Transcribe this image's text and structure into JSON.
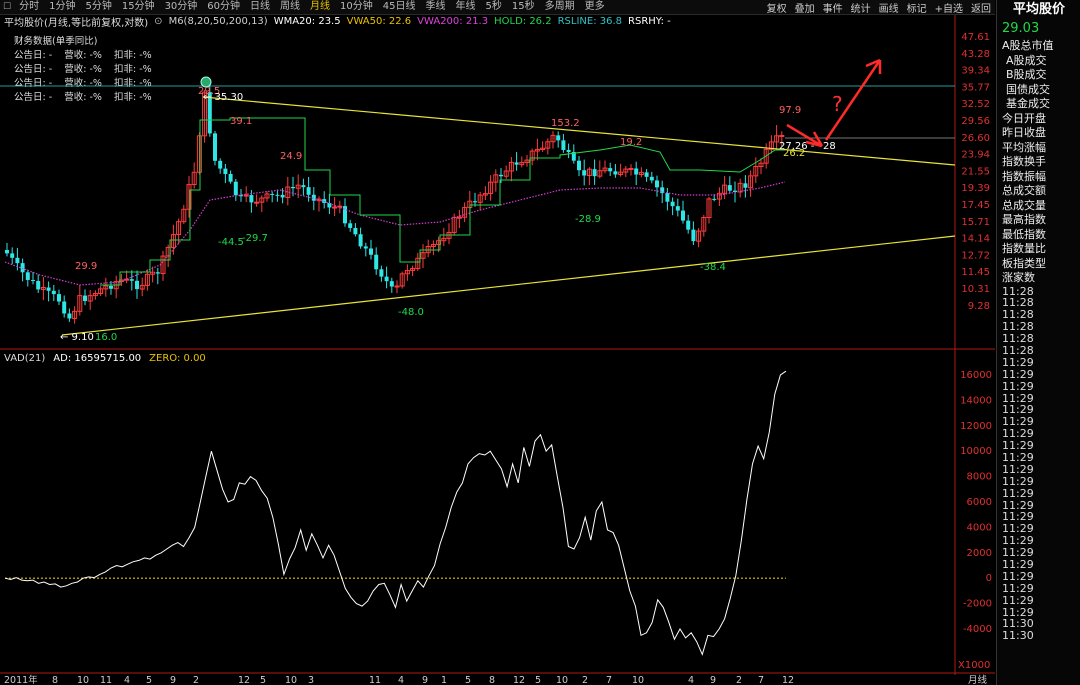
{
  "toolbar": {
    "periods": [
      "分时",
      "1分钟",
      "5分钟",
      "15分钟",
      "30分钟",
      "60分钟",
      "日线",
      "周线",
      "月线",
      "10分钟",
      "45日线",
      "季线",
      "年线",
      "5秒",
      "15秒",
      "多周期",
      "更多"
    ],
    "active_index": 8,
    "right": [
      "复权",
      "叠加",
      "事件",
      "统计",
      "画线",
      "标记",
      "+自选",
      "返回"
    ]
  },
  "main_indicator": {
    "name": "平均股价(月线,等比前复权,对数)",
    "items": [
      {
        "text": "M6(8,20,50,200,13)",
        "color": "#d0d0d0"
      },
      {
        "text": "WMA20: 23.5",
        "color": "#ffffff"
      },
      {
        "text": "VWA50: 22.6",
        "color": "#e8c100"
      },
      {
        "text": "VWA200: 21.3",
        "color": "#e040e0"
      },
      {
        "text": "HOLD: 26.2",
        "color": "#1fd94a"
      },
      {
        "text": "RSLINE: 36.8",
        "color": "#2ec4c4"
      },
      {
        "text": "RSRHY: -",
        "color": "#ffffff"
      }
    ]
  },
  "finance": {
    "title": "财务数据(单季同比)",
    "rows": [
      "公告日: -    营收: -%    扣非: -%",
      "公告日: -    营收: -%    扣非: -%",
      "公告日: -    营收: -%    扣非: -%",
      "公告日: -    营收: -%    扣非: -%"
    ]
  },
  "price_axis": [
    "47.61",
    "43.28",
    "39.34",
    "35.77",
    "32.52",
    "29.56",
    "26.60",
    "23.94",
    "21.55",
    "19.39",
    "17.45",
    "15.71",
    "14.14",
    "12.72",
    "11.45",
    "10.31",
    "9.28"
  ],
  "chart_labels": {
    "high_peak": "35.30",
    "peak_top": "29.5",
    "low": "9.10",
    "low_pct": "16.0",
    "pct_29_9": "29.9",
    "pct_neg44_5": "-44.5",
    "pct_neg29_7": "-29.7",
    "pct_39_1": "39.1",
    "pct_24_9": "24.9",
    "pct_neg48": "-48.0",
    "pct_153_2": "153.2",
    "pct_neg28_9": "-28.9",
    "pct_19_2": "19.2",
    "pct_neg38_4": "-38.4",
    "pct_97_9": "97.9",
    "last_price": "27.26",
    "last_price_b": "28",
    "hold_label": "26.2",
    "question": "?"
  },
  "sub_indicator": {
    "items": [
      {
        "text": "VAD(21)",
        "color": "#dddddd"
      },
      {
        "text": "AD: 16595715.00",
        "color": "#ffffff"
      },
      {
        "text": "ZERO: 0.00",
        "color": "#e8c100"
      }
    ],
    "axis": [
      "16000",
      "14000",
      "12000",
      "10000",
      "8000",
      "6000",
      "4000",
      "2000",
      "0",
      "-2000",
      "-4000"
    ],
    "unit": "X1000",
    "vad_values": [
      0,
      -100,
      50,
      -150,
      -200,
      -150,
      -400,
      -300,
      -500,
      -450,
      -700,
      -600,
      -400,
      -300,
      0,
      100,
      50,
      300,
      500,
      800,
      1000,
      900,
      1100,
      1300,
      1400,
      1600,
      1500,
      1800,
      2000,
      2300,
      2600,
      2800,
      2500,
      3200,
      4000,
      6000,
      8000,
      10000,
      8500,
      7000,
      6000,
      6200,
      7500,
      7400,
      8000,
      7700,
      6900,
      6300,
      4800,
      2700,
      300,
      1500,
      2400,
      3800,
      2200,
      3500,
      2600,
      1600,
      2600,
      1800,
      500,
      -800,
      -1500,
      -2000,
      -2200,
      -1800,
      -1000,
      -500,
      -400,
      -1300,
      -2300,
      -500,
      -1800,
      -1000,
      -200,
      -700,
      200,
      1000,
      2700,
      4000,
      5600,
      6800,
      7500,
      9000,
      9500,
      9800,
      9700,
      10000,
      9300,
      8600,
      7200,
      9000,
      7500,
      10300,
      8800,
      10800,
      11300,
      10000,
      10500,
      8000,
      5600,
      2500,
      2300,
      3200,
      4800,
      3000,
      5300,
      6000,
      3800,
      3600,
      2600,
      800,
      -1000,
      -2200,
      -4500,
      -4300,
      -3500,
      -1700,
      -2300,
      -3500,
      -4800,
      -4000,
      -4700,
      -4300,
      -5000,
      -6000,
      -4500,
      -4600,
      -4000,
      -3200,
      -1600,
      200,
      3000,
      6200,
      9000,
      10400,
      9400,
      11500,
      14500,
      16000,
      16300
    ],
    "zero_color": "#e8c100"
  },
  "date_axis": {
    "labels": [
      "2011年",
      "8",
      "10",
      "11",
      "4",
      "5",
      "9",
      "2",
      "12",
      "5",
      "10",
      "3",
      "11",
      "4",
      "9",
      "1",
      "5",
      "8",
      "12",
      "5",
      "10",
      "2",
      "7",
      "10",
      "4",
      "9",
      "2",
      "7",
      "12",
      "月线"
    ]
  },
  "panel": {
    "title": "平均股价",
    "price": "29.03",
    "items": [
      "A股总市值",
      "A股成交",
      "B股成交",
      "国债成交",
      "基金成交",
      "今日开盘",
      "昨日收盘",
      "平均涨幅",
      "指数换手",
      "指数振幅",
      "总成交额",
      "总成交量",
      "最高指数",
      "最低指数",
      "指数量比",
      "板指类型",
      "涨家数"
    ],
    "indent": [
      1,
      2,
      3,
      4
    ],
    "times": [
      "11:28",
      "11:28",
      "11:28",
      "11:28",
      "11:28",
      "11:28",
      "11:29",
      "11:29",
      "11:29",
      "11:29",
      "11:29",
      "11:29",
      "11:29",
      "11:29",
      "11:29",
      "11:29",
      "11:29",
      "11:29",
      "11:29",
      "11:29",
      "11:29",
      "11:29",
      "11:29",
      "11:29",
      "11:29",
      "11:29",
      "11:29",
      "11:29",
      "11:30",
      "11:30"
    ]
  },
  "colors": {
    "up": "#ff3b3b",
    "down": "#2ee6e6",
    "trend": "#e8e43a",
    "accent": "#e8c100"
  }
}
